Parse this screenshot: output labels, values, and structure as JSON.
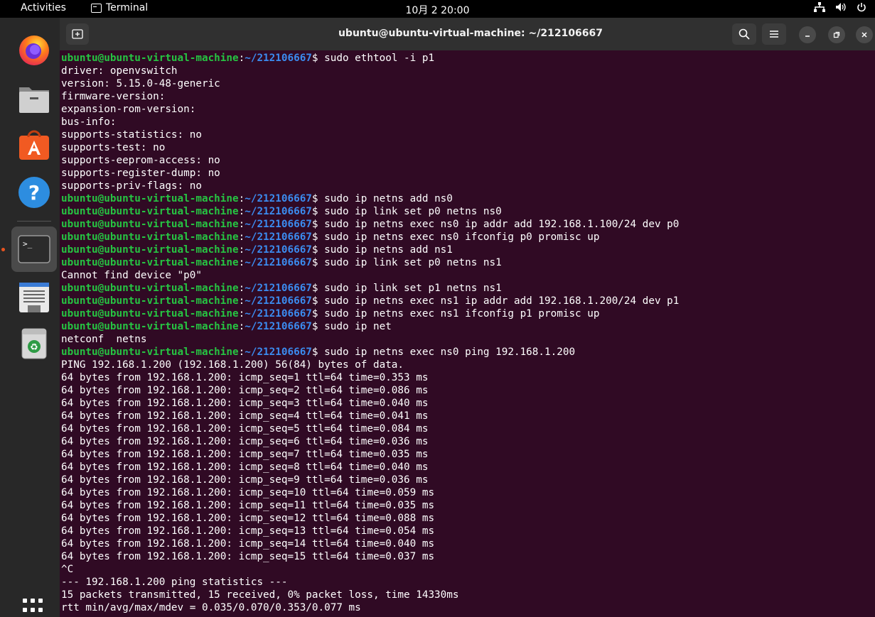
{
  "topbar": {
    "activities": "Activities",
    "app_name": "Terminal",
    "clock": "10月 2  20:00"
  },
  "dock": {
    "items": [
      "Firefox",
      "Files",
      "Ubuntu Software",
      "Help",
      "Terminal",
      "Text Editor",
      "Trash"
    ],
    "icons": [
      "firefox-icon",
      "files-icon",
      "software-icon",
      "help-icon",
      "terminal-icon",
      "text-editor-icon",
      "trash-icon"
    ],
    "active": "Terminal"
  },
  "window": {
    "title": "ubuntu@ubuntu-virtual-machine: ~/212106667"
  },
  "prompt": {
    "user_host": "ubuntu@ubuntu-virtual-machine",
    "path": "~/212106667",
    "symbol": "$ "
  },
  "terminal_lines": [
    {
      "type": "cmd",
      "text": "sudo ethtool -i p1"
    },
    {
      "type": "out",
      "text": "driver: openvswitch"
    },
    {
      "type": "out",
      "text": "version: 5.15.0-48-generic"
    },
    {
      "type": "out",
      "text": "firmware-version:"
    },
    {
      "type": "out",
      "text": "expansion-rom-version:"
    },
    {
      "type": "out",
      "text": "bus-info:"
    },
    {
      "type": "out",
      "text": "supports-statistics: no"
    },
    {
      "type": "out",
      "text": "supports-test: no"
    },
    {
      "type": "out",
      "text": "supports-eeprom-access: no"
    },
    {
      "type": "out",
      "text": "supports-register-dump: no"
    },
    {
      "type": "out",
      "text": "supports-priv-flags: no"
    },
    {
      "type": "cmd",
      "text": "sudo ip netns add ns0"
    },
    {
      "type": "cmd",
      "text": "sudo ip link set p0 netns ns0"
    },
    {
      "type": "cmd",
      "text": "sudo ip netns exec ns0 ip addr add 192.168.1.100/24 dev p0"
    },
    {
      "type": "cmd",
      "text": "sudo ip netns exec ns0 ifconfig p0 promisc up"
    },
    {
      "type": "cmd",
      "text": "sudo ip netns add ns1"
    },
    {
      "type": "cmd",
      "text": "sudo ip link set p0 netns ns1"
    },
    {
      "type": "out",
      "text": "Cannot find device \"p0\""
    },
    {
      "type": "cmd",
      "text": "sudo ip link set p1 netns ns1"
    },
    {
      "type": "cmd",
      "text": "sudo ip netns exec ns1 ip addr add 192.168.1.200/24 dev p1"
    },
    {
      "type": "cmd",
      "text": "sudo ip netns exec ns1 ifconfig p1 promisc up"
    },
    {
      "type": "cmd",
      "text": "sudo ip net"
    },
    {
      "type": "out",
      "text": "netconf  netns"
    },
    {
      "type": "cmd",
      "text": "sudo ip netns exec ns0 ping 192.168.1.200"
    },
    {
      "type": "out",
      "text": "PING 192.168.1.200 (192.168.1.200) 56(84) bytes of data."
    },
    {
      "type": "out",
      "text": "64 bytes from 192.168.1.200: icmp_seq=1 ttl=64 time=0.353 ms"
    },
    {
      "type": "out",
      "text": "64 bytes from 192.168.1.200: icmp_seq=2 ttl=64 time=0.086 ms"
    },
    {
      "type": "out",
      "text": "64 bytes from 192.168.1.200: icmp_seq=3 ttl=64 time=0.040 ms"
    },
    {
      "type": "out",
      "text": "64 bytes from 192.168.1.200: icmp_seq=4 ttl=64 time=0.041 ms"
    },
    {
      "type": "out",
      "text": "64 bytes from 192.168.1.200: icmp_seq=5 ttl=64 time=0.084 ms"
    },
    {
      "type": "out",
      "text": "64 bytes from 192.168.1.200: icmp_seq=6 ttl=64 time=0.036 ms"
    },
    {
      "type": "out",
      "text": "64 bytes from 192.168.1.200: icmp_seq=7 ttl=64 time=0.035 ms"
    },
    {
      "type": "out",
      "text": "64 bytes from 192.168.1.200: icmp_seq=8 ttl=64 time=0.040 ms"
    },
    {
      "type": "out",
      "text": "64 bytes from 192.168.1.200: icmp_seq=9 ttl=64 time=0.036 ms"
    },
    {
      "type": "out",
      "text": "64 bytes from 192.168.1.200: icmp_seq=10 ttl=64 time=0.059 ms"
    },
    {
      "type": "out",
      "text": "64 bytes from 192.168.1.200: icmp_seq=11 ttl=64 time=0.035 ms"
    },
    {
      "type": "out",
      "text": "64 bytes from 192.168.1.200: icmp_seq=12 ttl=64 time=0.088 ms"
    },
    {
      "type": "out",
      "text": "64 bytes from 192.168.1.200: icmp_seq=13 ttl=64 time=0.054 ms"
    },
    {
      "type": "out",
      "text": "64 bytes from 192.168.1.200: icmp_seq=14 ttl=64 time=0.040 ms"
    },
    {
      "type": "out",
      "text": "64 bytes from 192.168.1.200: icmp_seq=15 ttl=64 time=0.037 ms"
    },
    {
      "type": "out",
      "text": "^C"
    },
    {
      "type": "out",
      "text": "--- 192.168.1.200 ping statistics ---"
    },
    {
      "type": "out",
      "text": "15 packets transmitted, 15 received, 0% packet loss, time 14330ms"
    },
    {
      "type": "out",
      "text": "rtt min/avg/max/mdev = 0.035/0.070/0.353/0.077 ms"
    }
  ],
  "colors": {
    "terminal_bg": "#300a24",
    "prompt_user": "#26c442",
    "prompt_path": "#3b8cf0",
    "accent": "#e95420"
  }
}
